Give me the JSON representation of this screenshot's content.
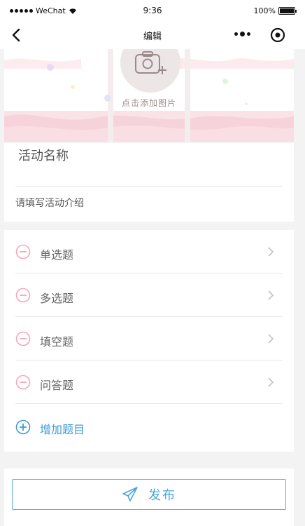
{
  "status_bar": {
    "carrier": "WeChat",
    "time": "9:36",
    "battery": "100%",
    "battery_level": 1.0
  },
  "nav": {
    "title": "编辑",
    "icons": [
      "back-chevron-icon",
      "more-dots-icon",
      "target-icon"
    ]
  },
  "banner": {
    "add_photo_text": "点击添加图片",
    "icon": "camera-plus-icon"
  },
  "activity": {
    "name": "活动名称",
    "intro_placeholder": "请填写活动介绍"
  },
  "questions": [
    {
      "label": "单选题",
      "icon": "minus-circle-icon"
    },
    {
      "label": "多选题",
      "icon": "minus-circle-icon"
    },
    {
      "label": "填空题",
      "icon": "minus-circle-icon"
    },
    {
      "label": "问答题",
      "icon": "minus-circle-icon"
    }
  ],
  "add_question": {
    "label": "增加题目",
    "icon": "plus-circle-icon"
  },
  "publish": {
    "label": "发布",
    "icon": "paper-plane-icon"
  },
  "colors": {
    "accent_blue": "#3f9bd3",
    "minus_pink": "#f2a9b8",
    "banner_pink": "#f9dbe1"
  }
}
